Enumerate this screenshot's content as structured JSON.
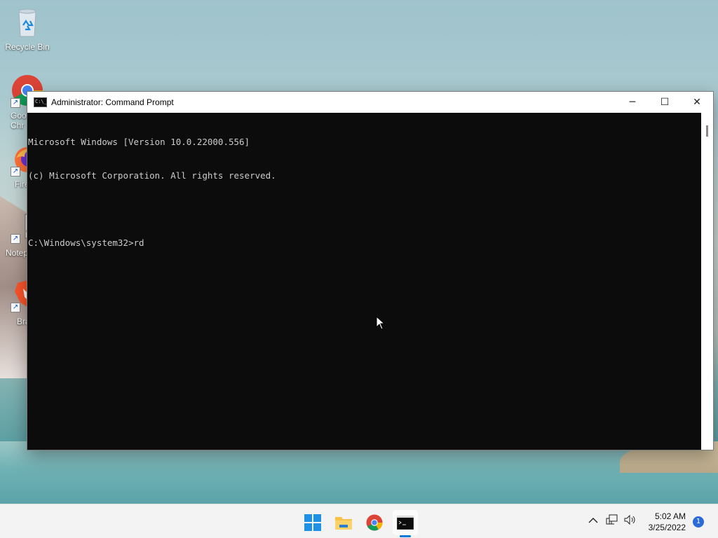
{
  "desktop": {
    "icons": [
      {
        "label": "Recycle Bin"
      },
      {
        "label": "Goo\nChr"
      },
      {
        "label": "Fire"
      },
      {
        "label": "Notep"
      },
      {
        "label": "Bra"
      }
    ]
  },
  "window": {
    "title": "Administrator: Command Prompt",
    "title_icon_text": "C:\\_",
    "controls": {
      "minimize": "─",
      "maximize": "☐",
      "close": "✕"
    },
    "console_lines": [
      "Microsoft Windows [Version 10.0.22000.556]",
      "(c) Microsoft Corporation. All rights reserved.",
      "",
      "C:\\Windows\\system32>rd"
    ]
  },
  "taskbar": {
    "apps": [
      {
        "name": "Start"
      },
      {
        "name": "File Explorer"
      },
      {
        "name": "Google Chrome"
      },
      {
        "name": "Command Prompt",
        "active": true
      }
    ],
    "clock": {
      "time": "5:02 AM",
      "date": "3/25/2022"
    },
    "notification_count": "1",
    "accent": "#0078d4"
  }
}
